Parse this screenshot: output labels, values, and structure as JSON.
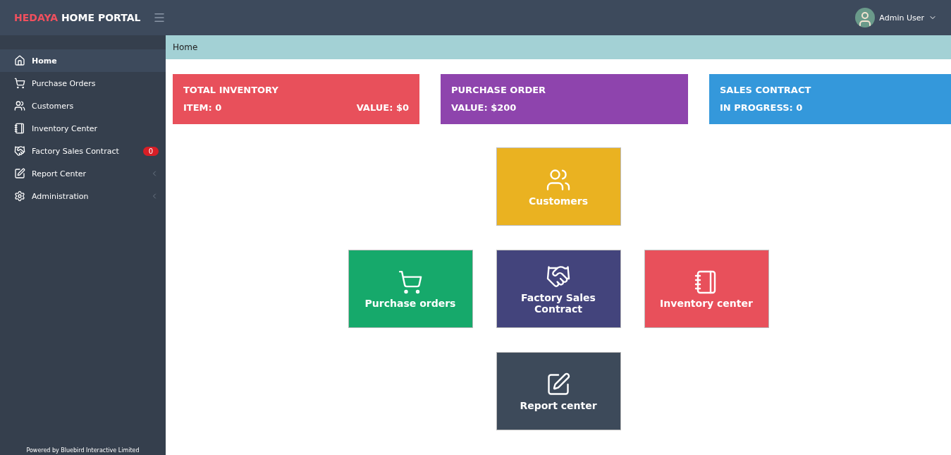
{
  "header": {
    "brand_accent": "HEDAYA",
    "brand": "HOME PORTAL",
    "user": "Admin User"
  },
  "sidebar": {
    "items": [
      {
        "label": "Home",
        "selected": true,
        "has_submenu": false
      },
      {
        "label": "Purchase Orders",
        "selected": false,
        "has_submenu": false
      },
      {
        "label": "Customers",
        "selected": false,
        "has_submenu": false
      },
      {
        "label": "Inventory Center",
        "selected": false,
        "has_submenu": false
      },
      {
        "label": "Factory Sales Contract",
        "selected": false,
        "has_submenu": false,
        "badge": "0"
      },
      {
        "label": "Report Center",
        "selected": false,
        "has_submenu": true
      },
      {
        "label": "Administration",
        "selected": false,
        "has_submenu": true
      }
    ],
    "footer": "Powered by Bluebird Interactive Limited"
  },
  "breadcrumb": "Home",
  "stats": [
    {
      "title": "TOTAL INVENTORY",
      "color": "#e8505b",
      "values": [
        "ITEM:  0",
        "VALUE:  $0"
      ]
    },
    {
      "title": "PURCHASE ORDER",
      "color": "#8e44ad",
      "values": [
        "VALUE:  $200"
      ]
    },
    {
      "title": "SALES CONTRACT",
      "color": "#3498db",
      "values": [
        "IN PROGRESS: 0"
      ]
    }
  ],
  "tile_rows": [
    [
      {
        "label": "Customers",
        "color": "#eab221"
      }
    ],
    [
      {
        "label": "Purchase orders",
        "color": "#16a96b"
      },
      {
        "label": "Factory Sales Contract",
        "color": "#43447c"
      },
      {
        "label": "Inventory center",
        "color": "#e8505b"
      }
    ],
    [
      {
        "label": "Report center",
        "color": "#3d4a5a"
      }
    ]
  ]
}
